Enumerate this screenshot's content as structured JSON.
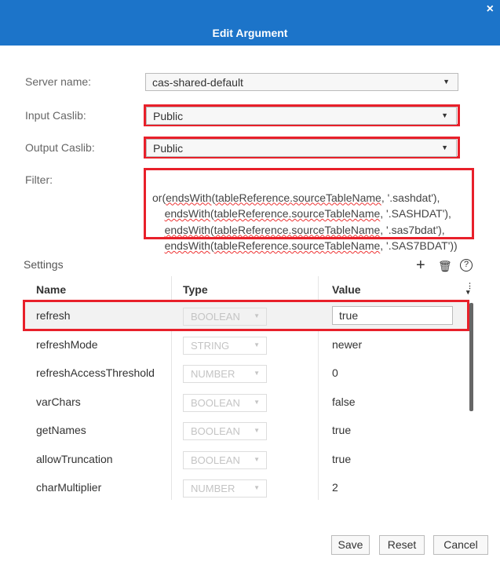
{
  "dialog": {
    "title": "Edit Argument",
    "close_icon": "×"
  },
  "form": {
    "server_label": "Server name:",
    "server_value": "cas-shared-default",
    "input_label": "Input Caslib:",
    "input_value": "Public",
    "output_label": "Output Caslib:",
    "output_value": "Public",
    "filter_label": "Filter:",
    "filter_lines": [
      {
        "pre": "or(",
        "fn": "endsWith",
        "arg": "tableReference.sourceTableName",
        "post": ", '.sashdat'),"
      },
      {
        "pre": "    ",
        "fn": "endsWith",
        "arg": "tableReference.sourceTableName",
        "post": ", '.SASHDAT'),"
      },
      {
        "pre": "    ",
        "fn": "endsWith",
        "arg": "tableReference.sourceTableName",
        "post": ", '.sas7bdat'),"
      },
      {
        "pre": "    ",
        "fn": "endsWith",
        "arg": "tableReference.sourceTableName",
        "post": ", '.SAS7BDAT'))"
      }
    ]
  },
  "settings": {
    "label": "Settings",
    "add": "+",
    "delete": "🗑",
    "help": "?",
    "columns": [
      "Name",
      "Type",
      "Value"
    ],
    "rows": [
      {
        "name": "refresh",
        "type": "BOOLEAN",
        "value": "true"
      },
      {
        "name": "refreshMode",
        "type": "STRING",
        "value": "newer"
      },
      {
        "name": "refreshAccessThreshold",
        "type": "NUMBER",
        "value": "0"
      },
      {
        "name": "varChars",
        "type": "BOOLEAN",
        "value": "false"
      },
      {
        "name": "getNames",
        "type": "BOOLEAN",
        "value": "true"
      },
      {
        "name": "allowTruncation",
        "type": "BOOLEAN",
        "value": "true"
      },
      {
        "name": "charMultiplier",
        "type": "NUMBER",
        "value": "2"
      }
    ]
  },
  "buttons": {
    "save": "Save",
    "reset": "Reset",
    "cancel": "Cancel"
  },
  "colors": {
    "header": "#1c74c9",
    "highlight": "#e8202a"
  }
}
